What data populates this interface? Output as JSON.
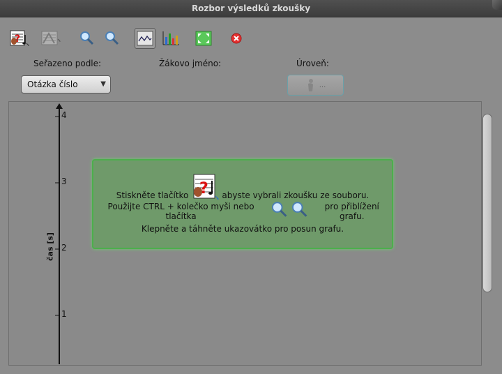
{
  "window": {
    "title": "Rozbor výsledků zkoušky"
  },
  "toolbar": {
    "buttons": [
      {
        "name": "open-exam-icon",
        "active": false
      },
      {
        "name": "exam-settings-icon",
        "active": false
      },
      {
        "name": "zoom-in-icon",
        "active": false
      },
      {
        "name": "zoom-out-icon",
        "active": false
      },
      {
        "name": "line-chart-icon",
        "active": true
      },
      {
        "name": "bar-chart-icon",
        "active": false
      },
      {
        "name": "fit-view-icon",
        "active": false
      },
      {
        "name": "close-icon",
        "active": false
      }
    ]
  },
  "filters": {
    "sort_label": "Seřazeno podle:",
    "sort_value": "Otázka číslo",
    "student_label": "Žákovo jméno:",
    "level_label": "Úroveň:",
    "level_button_text": "..."
  },
  "chart_data": {
    "type": "line",
    "ylabel": "čas [s]",
    "y_ticks": [
      "1",
      "2",
      "3",
      "4"
    ],
    "ylim": [
      0.25,
      4.15
    ],
    "series": []
  },
  "info_box": {
    "line1_before": "Stiskněte tlačítko",
    "line1_after": "abyste vybrali zkoušku ze souboru.",
    "line2_before": "Použijte CTRL + kolečko myši nebo tlačítka",
    "line2_after": "pro přiblížení grafu.",
    "line3": "Klepněte a táhněte ukazovátko pro posun grafu."
  },
  "colors": {
    "accent_green": "#4caf4c",
    "background": "#8c8c8c"
  }
}
